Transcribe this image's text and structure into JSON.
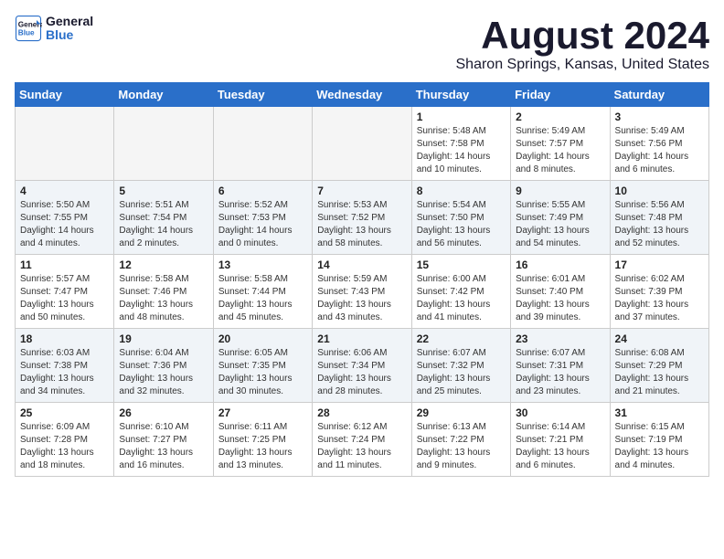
{
  "logo": {
    "line1": "General",
    "line2": "Blue"
  },
  "title": "August 2024",
  "subtitle": "Sharon Springs, Kansas, United States",
  "days_of_week": [
    "Sunday",
    "Monday",
    "Tuesday",
    "Wednesday",
    "Thursday",
    "Friday",
    "Saturday"
  ],
  "weeks": [
    [
      {
        "num": "",
        "empty": true
      },
      {
        "num": "",
        "empty": true
      },
      {
        "num": "",
        "empty": true
      },
      {
        "num": "",
        "empty": true
      },
      {
        "num": "1",
        "sunrise": "5:48 AM",
        "sunset": "7:58 PM",
        "daylight": "14 hours and 10 minutes."
      },
      {
        "num": "2",
        "sunrise": "5:49 AM",
        "sunset": "7:57 PM",
        "daylight": "14 hours and 8 minutes."
      },
      {
        "num": "3",
        "sunrise": "5:49 AM",
        "sunset": "7:56 PM",
        "daylight": "14 hours and 6 minutes."
      }
    ],
    [
      {
        "num": "4",
        "sunrise": "5:50 AM",
        "sunset": "7:55 PM",
        "daylight": "14 hours and 4 minutes."
      },
      {
        "num": "5",
        "sunrise": "5:51 AM",
        "sunset": "7:54 PM",
        "daylight": "14 hours and 2 minutes."
      },
      {
        "num": "6",
        "sunrise": "5:52 AM",
        "sunset": "7:53 PM",
        "daylight": "14 hours and 0 minutes."
      },
      {
        "num": "7",
        "sunrise": "5:53 AM",
        "sunset": "7:52 PM",
        "daylight": "13 hours and 58 minutes."
      },
      {
        "num": "8",
        "sunrise": "5:54 AM",
        "sunset": "7:50 PM",
        "daylight": "13 hours and 56 minutes."
      },
      {
        "num": "9",
        "sunrise": "5:55 AM",
        "sunset": "7:49 PM",
        "daylight": "13 hours and 54 minutes."
      },
      {
        "num": "10",
        "sunrise": "5:56 AM",
        "sunset": "7:48 PM",
        "daylight": "13 hours and 52 minutes."
      }
    ],
    [
      {
        "num": "11",
        "sunrise": "5:57 AM",
        "sunset": "7:47 PM",
        "daylight": "13 hours and 50 minutes."
      },
      {
        "num": "12",
        "sunrise": "5:58 AM",
        "sunset": "7:46 PM",
        "daylight": "13 hours and 48 minutes."
      },
      {
        "num": "13",
        "sunrise": "5:58 AM",
        "sunset": "7:44 PM",
        "daylight": "13 hours and 45 minutes."
      },
      {
        "num": "14",
        "sunrise": "5:59 AM",
        "sunset": "7:43 PM",
        "daylight": "13 hours and 43 minutes."
      },
      {
        "num": "15",
        "sunrise": "6:00 AM",
        "sunset": "7:42 PM",
        "daylight": "13 hours and 41 minutes."
      },
      {
        "num": "16",
        "sunrise": "6:01 AM",
        "sunset": "7:40 PM",
        "daylight": "13 hours and 39 minutes."
      },
      {
        "num": "17",
        "sunrise": "6:02 AM",
        "sunset": "7:39 PM",
        "daylight": "13 hours and 37 minutes."
      }
    ],
    [
      {
        "num": "18",
        "sunrise": "6:03 AM",
        "sunset": "7:38 PM",
        "daylight": "13 hours and 34 minutes."
      },
      {
        "num": "19",
        "sunrise": "6:04 AM",
        "sunset": "7:36 PM",
        "daylight": "13 hours and 32 minutes."
      },
      {
        "num": "20",
        "sunrise": "6:05 AM",
        "sunset": "7:35 PM",
        "daylight": "13 hours and 30 minutes."
      },
      {
        "num": "21",
        "sunrise": "6:06 AM",
        "sunset": "7:34 PM",
        "daylight": "13 hours and 28 minutes."
      },
      {
        "num": "22",
        "sunrise": "6:07 AM",
        "sunset": "7:32 PM",
        "daylight": "13 hours and 25 minutes."
      },
      {
        "num": "23",
        "sunrise": "6:07 AM",
        "sunset": "7:31 PM",
        "daylight": "13 hours and 23 minutes."
      },
      {
        "num": "24",
        "sunrise": "6:08 AM",
        "sunset": "7:29 PM",
        "daylight": "13 hours and 21 minutes."
      }
    ],
    [
      {
        "num": "25",
        "sunrise": "6:09 AM",
        "sunset": "7:28 PM",
        "daylight": "13 hours and 18 minutes."
      },
      {
        "num": "26",
        "sunrise": "6:10 AM",
        "sunset": "7:27 PM",
        "daylight": "13 hours and 16 minutes."
      },
      {
        "num": "27",
        "sunrise": "6:11 AM",
        "sunset": "7:25 PM",
        "daylight": "13 hours and 13 minutes."
      },
      {
        "num": "28",
        "sunrise": "6:12 AM",
        "sunset": "7:24 PM",
        "daylight": "13 hours and 11 minutes."
      },
      {
        "num": "29",
        "sunrise": "6:13 AM",
        "sunset": "7:22 PM",
        "daylight": "13 hours and 9 minutes."
      },
      {
        "num": "30",
        "sunrise": "6:14 AM",
        "sunset": "7:21 PM",
        "daylight": "13 hours and 6 minutes."
      },
      {
        "num": "31",
        "sunrise": "6:15 AM",
        "sunset": "7:19 PM",
        "daylight": "13 hours and 4 minutes."
      }
    ]
  ]
}
